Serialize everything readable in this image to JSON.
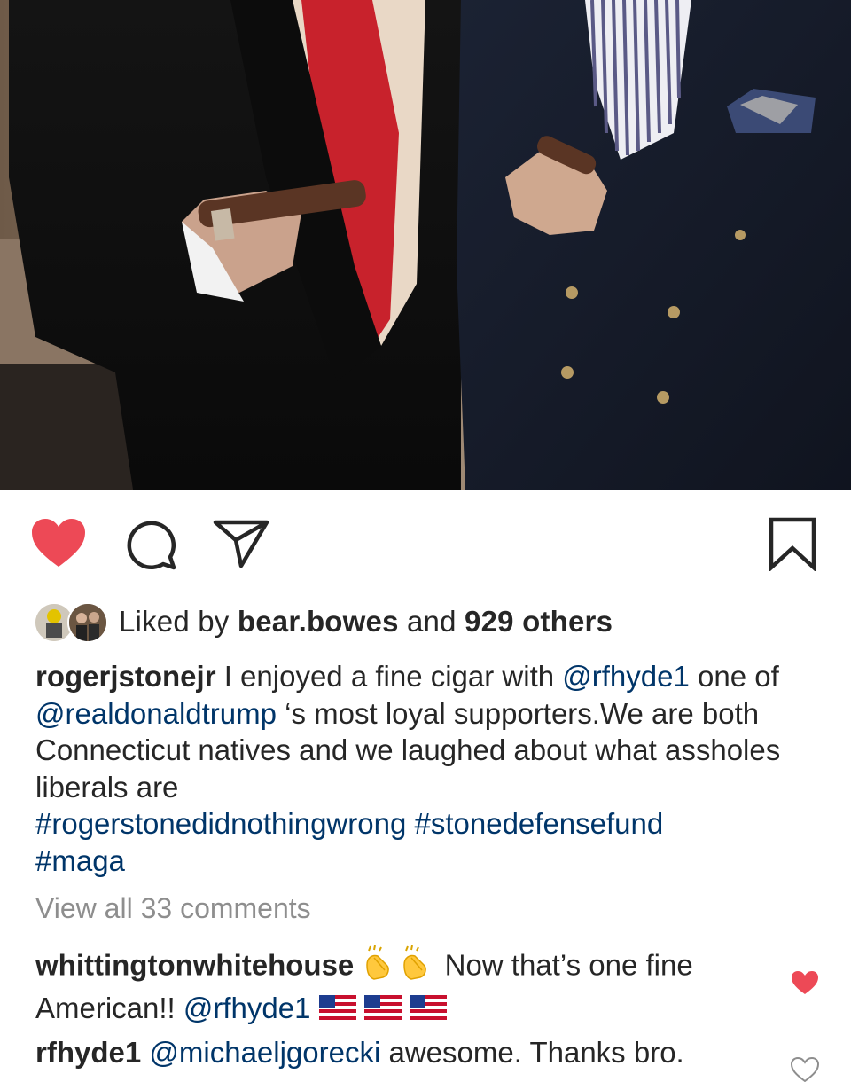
{
  "photo": {
    "subject": "two men in suits holding cigars"
  },
  "actions": {
    "like_icon": "heart-filled-icon",
    "comment_icon": "comment-icon",
    "share_icon": "send-icon",
    "save_icon": "bookmark-icon",
    "like_color": "#ed4956"
  },
  "likes": {
    "prefix": "Liked by ",
    "user": "bear.bowes",
    "middle": " and ",
    "others": "929 others"
  },
  "caption": {
    "username": "rogerjstonejr",
    "text1": " I enjoyed a fine cigar with ",
    "mention1": "@rfhyde1",
    "text2": " one of ",
    "mention2": "@realdonaldtrump",
    "text3": " ‘s most loyal supporters.We are both Connecticut natives and we laughed about what assholes liberals are ",
    "hashtag1": "#rogerstonedidnothingwrong",
    "hashtag2": "#stonedefensefund",
    "hashtag3": "#maga"
  },
  "view_all": "View all 33 comments",
  "comments": [
    {
      "username": "whittingtonwhitehouse",
      "text_after_emoji": " Now that’s one fine American!! ",
      "mention": "@rfhyde1",
      "emojis": [
        "clapping-hands-icon",
        "clapping-hands-icon",
        "us-flag-icon",
        "us-flag-icon",
        "us-flag-icon"
      ],
      "liked": true
    },
    {
      "username": "rfhyde1",
      "mention": "@michaeljgorecki",
      "text": " awesome. Thanks bro.",
      "liked": false
    }
  ]
}
